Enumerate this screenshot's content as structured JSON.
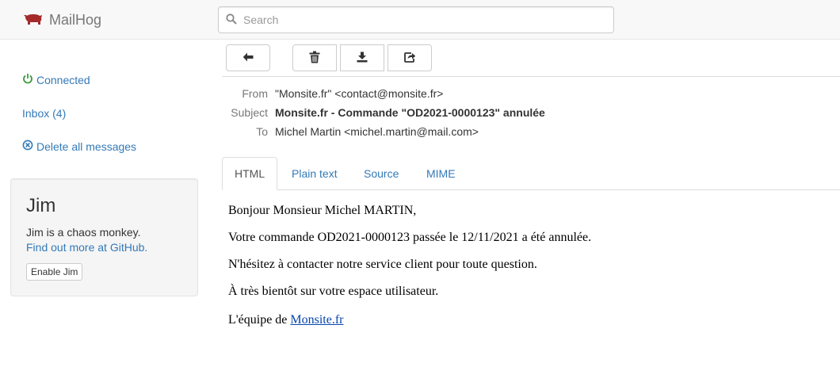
{
  "app": {
    "title": "MailHog",
    "brand_color": "#a52a2a"
  },
  "search": {
    "placeholder": "Search",
    "value": ""
  },
  "sidebar": {
    "connected_label": "Connected",
    "inbox_label": "Inbox (4)",
    "delete_all_label": "Delete all messages",
    "status_color": "#3c9a3c"
  },
  "jim": {
    "title": "Jim",
    "description": "Jim is a chaos monkey.",
    "link_label": "Find out more at GitHub.",
    "button_label": "Enable Jim"
  },
  "toolbar": {
    "icons": [
      "arrow-left-icon",
      "trash-icon",
      "download-icon",
      "share-icon"
    ]
  },
  "message": {
    "headers": {
      "from_label": "From",
      "from_value": "\"Monsite.fr\" <contact@monsite.fr>",
      "subject_label": "Subject",
      "subject_value": "Monsite.fr - Commande \"OD2021-0000123\" annulée",
      "to_label": "To",
      "to_value": "Michel Martin <michel.martin@mail.com>"
    },
    "tabs": [
      {
        "label": "HTML",
        "active": true
      },
      {
        "label": "Plain text",
        "active": false
      },
      {
        "label": "Source",
        "active": false
      },
      {
        "label": "MIME",
        "active": false
      }
    ],
    "body": {
      "greeting": "Bonjour Monsieur Michel MARTIN,",
      "line2": "Votre commande OD2021-0000123 passée le 12/11/2021 a été annulée.",
      "line3": "N'hésitez à contacter notre service client pour toute question.",
      "line4": "À très bientôt sur votre espace utilisateur.",
      "signature_prefix": "L'équipe de ",
      "signature_link": "Monsite.fr"
    }
  }
}
